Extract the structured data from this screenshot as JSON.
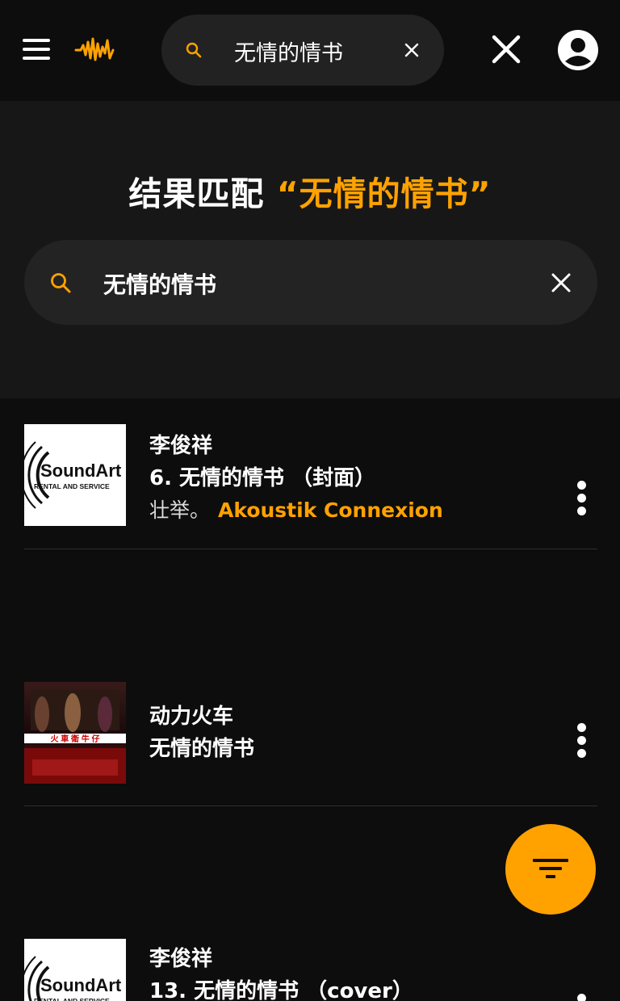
{
  "header": {
    "search_query": "无情的情书",
    "menu_icon": "hamburger-icon",
    "logo": "audiomack-waveform-logo",
    "accent": "#ffa200"
  },
  "hero": {
    "title_prefix": "结果匹配 ",
    "title_query": "“无情的情书”"
  },
  "search": {
    "value": "无情的情书"
  },
  "results": [
    {
      "artist": "李俊祥",
      "track": "6. 无情的情书 （封面）",
      "meta_prefix": "壮举。",
      "meta_label": "Akoustik Connexion",
      "cover": "soundart-logo"
    },
    {
      "artist": "动力火车",
      "track": "无情的情书",
      "cover": "live-concert-photo"
    },
    {
      "artist": "李俊祥",
      "track": "13. 无情的情书 （cover）",
      "cover": "soundart-logo"
    }
  ],
  "soundart": {
    "name": "SoundArt",
    "sub": "RENTAL AND SERVICE"
  },
  "fab": {
    "icon": "filter-icon"
  }
}
